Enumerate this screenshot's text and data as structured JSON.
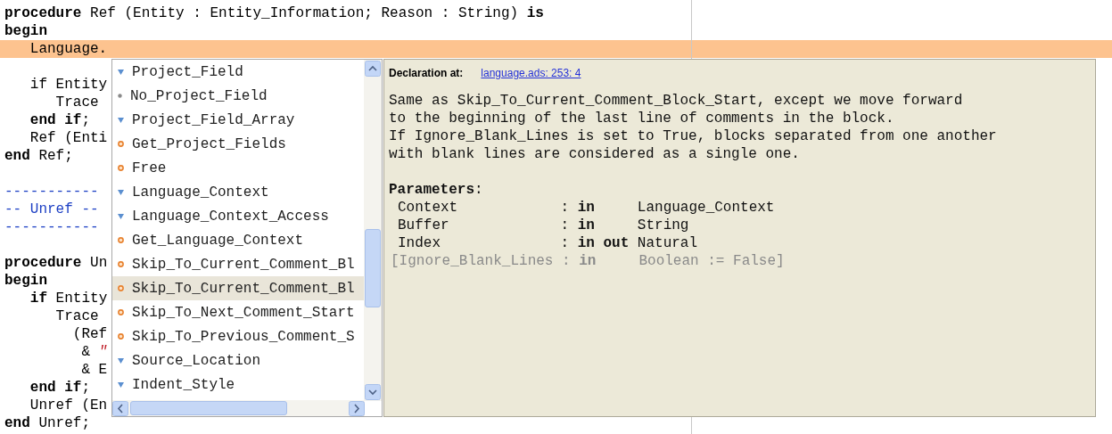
{
  "editor": {
    "blocks": [
      [
        {
          "highlighted": false,
          "tokens": [
            {
              "text": "procedure",
              "kind": "keyword"
            },
            {
              "text": " Ref (Entity : Entity_Information; Reason : String) ",
              "kind": "plain"
            },
            {
              "text": "is",
              "kind": "keyword"
            }
          ]
        },
        {
          "highlighted": false,
          "tokens": [
            {
              "text": "begin",
              "kind": "keyword"
            }
          ]
        },
        {
          "highlighted": true,
          "tokens": [
            {
              "text": "   Language.",
              "kind": "plain"
            }
          ]
        }
      ],
      [
        {
          "highlighted": false,
          "tokens": [
            {
              "text": "   if Entity",
              "kind": "plain"
            }
          ]
        },
        {
          "highlighted": false,
          "tokens": [
            {
              "text": "      Trace",
              "kind": "plain"
            }
          ]
        },
        {
          "highlighted": false,
          "tokens": [
            {
              "text": "   end if",
              "kind": "keyword"
            },
            {
              "text": ";",
              "kind": "plain"
            }
          ]
        },
        {
          "highlighted": false,
          "tokens": [
            {
              "text": "   Ref (Enti",
              "kind": "plain"
            }
          ]
        },
        {
          "highlighted": false,
          "tokens": [
            {
              "text": "end",
              "kind": "keyword"
            },
            {
              "text": " Ref;",
              "kind": "plain"
            }
          ]
        }
      ],
      [
        {
          "highlighted": false,
          "tokens": [
            {
              "text": "-----------",
              "kind": "comment"
            }
          ]
        },
        {
          "highlighted": false,
          "tokens": [
            {
              "text": "-- Unref --",
              "kind": "comment"
            }
          ]
        },
        {
          "highlighted": false,
          "tokens": [
            {
              "text": "-----------",
              "kind": "comment"
            }
          ]
        }
      ],
      [
        {
          "highlighted": false,
          "tokens": [
            {
              "text": "procedure",
              "kind": "keyword"
            },
            {
              "text": " Un",
              "kind": "plain"
            }
          ]
        },
        {
          "highlighted": false,
          "tokens": [
            {
              "text": "begin",
              "kind": "keyword"
            }
          ]
        },
        {
          "highlighted": false,
          "tokens": [
            {
              "text": "   if",
              "kind": "keyword"
            },
            {
              "text": " Entity",
              "kind": "plain"
            }
          ]
        },
        {
          "highlighted": false,
          "tokens": [
            {
              "text": "      Trace",
              "kind": "plain"
            }
          ]
        },
        {
          "highlighted": false,
          "tokens": [
            {
              "text": "        (Ref",
              "kind": "plain"
            }
          ]
        },
        {
          "highlighted": false,
          "tokens": [
            {
              "text": "         & ",
              "kind": "plain"
            },
            {
              "text": "\"",
              "kind": "string"
            }
          ]
        },
        {
          "highlighted": false,
          "tokens": [
            {
              "text": "         & E",
              "kind": "plain"
            }
          ]
        },
        {
          "highlighted": false,
          "tokens": [
            {
              "text": "   end if",
              "kind": "keyword"
            },
            {
              "text": ";",
              "kind": "plain"
            }
          ]
        },
        {
          "highlighted": false,
          "tokens": [
            {
              "text": "   Unref (En",
              "kind": "plain"
            }
          ]
        },
        {
          "highlighted": false,
          "tokens": [
            {
              "text": "end",
              "kind": "keyword"
            },
            {
              "text": " Unref;",
              "kind": "plain"
            }
          ]
        }
      ]
    ]
  },
  "completion": {
    "items": [
      {
        "label": "Project_Field",
        "kind": "type",
        "selected": false
      },
      {
        "label": "No_Project_Field",
        "kind": "object",
        "selected": false
      },
      {
        "label": "Project_Field_Array",
        "kind": "type",
        "selected": false
      },
      {
        "label": "Get_Project_Fields",
        "kind": "subprogram",
        "selected": false
      },
      {
        "label": "Free",
        "kind": "subprogram",
        "selected": false
      },
      {
        "label": "Language_Context",
        "kind": "type",
        "selected": false
      },
      {
        "label": "Language_Context_Access",
        "kind": "type",
        "selected": false
      },
      {
        "label": "Get_Language_Context",
        "kind": "subprogram",
        "selected": false
      },
      {
        "label": "Skip_To_Current_Comment_Bl",
        "kind": "subprogram",
        "selected": false
      },
      {
        "label": "Skip_To_Current_Comment_Bl",
        "kind": "subprogram",
        "selected": true
      },
      {
        "label": "Skip_To_Next_Comment_Start",
        "kind": "subprogram",
        "selected": false
      },
      {
        "label": "Skip_To_Previous_Comment_S",
        "kind": "subprogram",
        "selected": false
      },
      {
        "label": "Source_Location",
        "kind": "type",
        "selected": false
      },
      {
        "label": "Indent_Style",
        "kind": "type",
        "selected": false
      }
    ]
  },
  "documentation": {
    "declaration_label": "Declaration at:",
    "declaration_link": "language.ads: 253: 4",
    "description": [
      "Same as Skip_To_Current_Comment_Block_Start, except we move forward",
      "to the beginning of the last line of comments in the block.",
      "If Ignore_Blank_Lines is set to True, blocks separated from one another",
      "with blank lines are considered as a single one."
    ],
    "parameters_heading": "**Parameters**:",
    "parameters": [
      {
        "name": "Context",
        "mode": ": **in**",
        "type": "Language_Context",
        "optional": false
      },
      {
        "name": "Buffer",
        "mode": ": **in**",
        "type": "String",
        "optional": false
      },
      {
        "name": "Index",
        "mode": ": **in out**",
        "type": "Natural",
        "optional": false
      },
      {
        "name": "[Ignore_Blank_Lines",
        "mode": ": **in**",
        "type": "Boolean := False]",
        "optional": true
      }
    ]
  }
}
